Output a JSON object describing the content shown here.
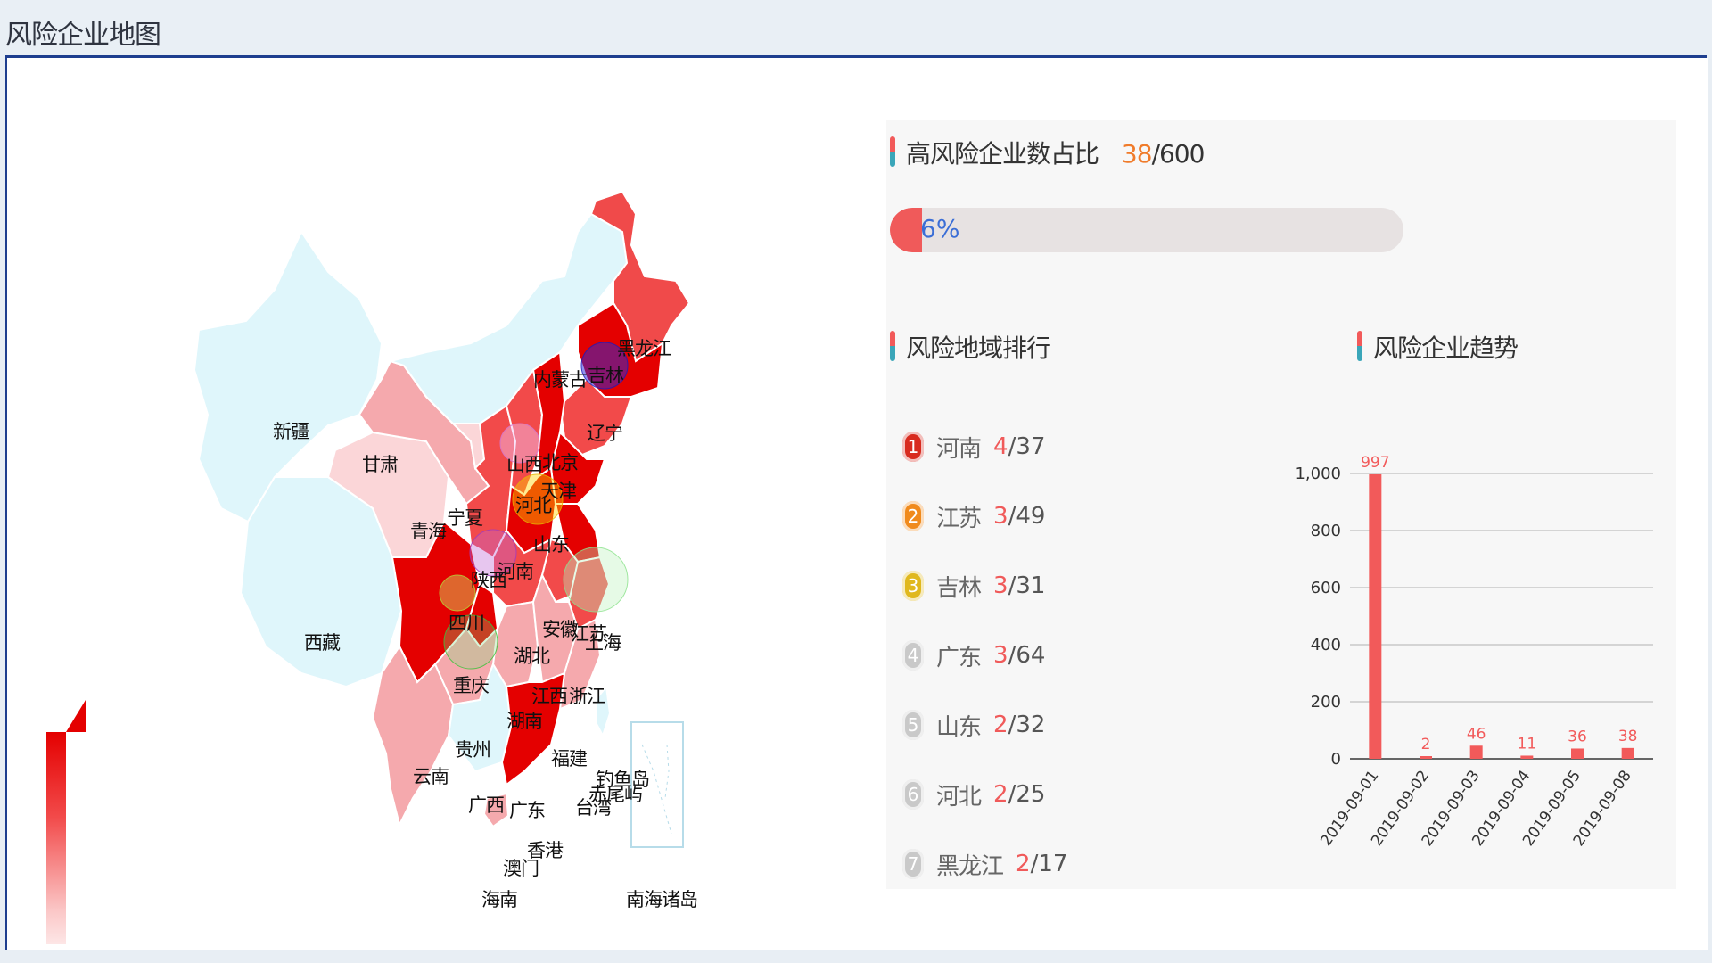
{
  "page": {
    "title": "风险企业地图"
  },
  "map": {
    "provinces": [
      {
        "name": "黑龙江",
        "fill": "#f04a4a"
      },
      {
        "name": "吉林",
        "fill": "#e40000"
      },
      {
        "name": "内蒙古",
        "fill": "#dff6fb"
      },
      {
        "name": "辽宁",
        "fill": "#f24a4a"
      },
      {
        "name": "新疆",
        "fill": "#dff6fb"
      },
      {
        "name": "甘肃",
        "fill": "#f5a9ad"
      },
      {
        "name": "北京",
        "fill": "#f24a4a"
      },
      {
        "name": "山西",
        "fill": "#f24a4a"
      },
      {
        "name": "天津",
        "fill": "#f24a4a"
      },
      {
        "name": "河北",
        "fill": "#e40000"
      },
      {
        "name": "宁夏",
        "fill": "#fbd6d8"
      },
      {
        "name": "青海",
        "fill": "#fbd6d8"
      },
      {
        "name": "山东",
        "fill": "#e40000"
      },
      {
        "name": "陕西",
        "fill": "#f24a4a"
      },
      {
        "name": "河南",
        "fill": "#e40000"
      },
      {
        "name": "西藏",
        "fill": "#dff6fb"
      },
      {
        "name": "四川",
        "fill": "#e40000"
      },
      {
        "name": "安徽",
        "fill": "#f24a4a"
      },
      {
        "name": "江苏",
        "fill": "#e40000"
      },
      {
        "name": "上海",
        "fill": "#e40000"
      },
      {
        "name": "湖北",
        "fill": "#f24a4a"
      },
      {
        "name": "重庆",
        "fill": "#e40000"
      },
      {
        "name": "浙江",
        "fill": "#f24a4a"
      },
      {
        "name": "江西",
        "fill": "#f5a9ad"
      },
      {
        "name": "湖南",
        "fill": "#f5a9ad"
      },
      {
        "name": "贵州",
        "fill": "#f5a9ad"
      },
      {
        "name": "福建",
        "fill": "#f5a9ad"
      },
      {
        "name": "云南",
        "fill": "#f5a9ad"
      },
      {
        "name": "钓鱼岛",
        "fill": "#dff6fb"
      },
      {
        "name": "赤尾屿",
        "fill": "#dff6fb"
      },
      {
        "name": "广西",
        "fill": "#dff6fb"
      },
      {
        "name": "广东",
        "fill": "#e40000"
      },
      {
        "name": "台湾",
        "fill": "#dff6fb"
      },
      {
        "name": "香港",
        "fill": "#f5a9ad"
      },
      {
        "name": "澳门",
        "fill": "#f5a9ad"
      },
      {
        "name": "海南",
        "fill": "#f5a9ad"
      },
      {
        "name": "南海诸岛",
        "fill": "#ffffff"
      }
    ],
    "legend": {
      "high_color": "#e40000",
      "low_color": "#fde6e6"
    }
  },
  "ratio": {
    "label": "高风险企业数占比",
    "value": "38",
    "total": "/600",
    "percent_text": "6%",
    "fraction": 0.063
  },
  "ranking": {
    "title": "风险地域排行",
    "items": [
      {
        "rank": "1",
        "name": "河南",
        "high": "4",
        "total": "/37",
        "color": "#d82b1f"
      },
      {
        "rank": "2",
        "name": "江苏",
        "high": "3",
        "total": "/49",
        "color": "#f08a1c"
      },
      {
        "rank": "3",
        "name": "吉林",
        "high": "3",
        "total": "/31",
        "color": "#e0b81e"
      },
      {
        "rank": "4",
        "name": "广东",
        "high": "3",
        "total": "/64",
        "color": "#c9c9c9"
      },
      {
        "rank": "5",
        "name": "山东",
        "high": "2",
        "total": "/32",
        "color": "#c9c9c9"
      },
      {
        "rank": "6",
        "name": "河北",
        "high": "2",
        "total": "/25",
        "color": "#c9c9c9"
      },
      {
        "rank": "7",
        "name": "黑龙江",
        "high": "2",
        "total": "/17",
        "color": "#c9c9c9"
      }
    ]
  },
  "trend": {
    "title": "风险企业趋势"
  },
  "chart_data": {
    "type": "bar",
    "categories": [
      "2019-09-01",
      "2019-09-02",
      "2019-09-03",
      "2019-09-04",
      "2019-09-05",
      "2019-09-08"
    ],
    "values": [
      997,
      2,
      46,
      11,
      36,
      38
    ],
    "ylim": [
      0,
      1000
    ],
    "yticks": [
      "0",
      "200",
      "400",
      "600",
      "800",
      "1,000"
    ],
    "grid": true,
    "bar_color": "#f25a5a"
  }
}
